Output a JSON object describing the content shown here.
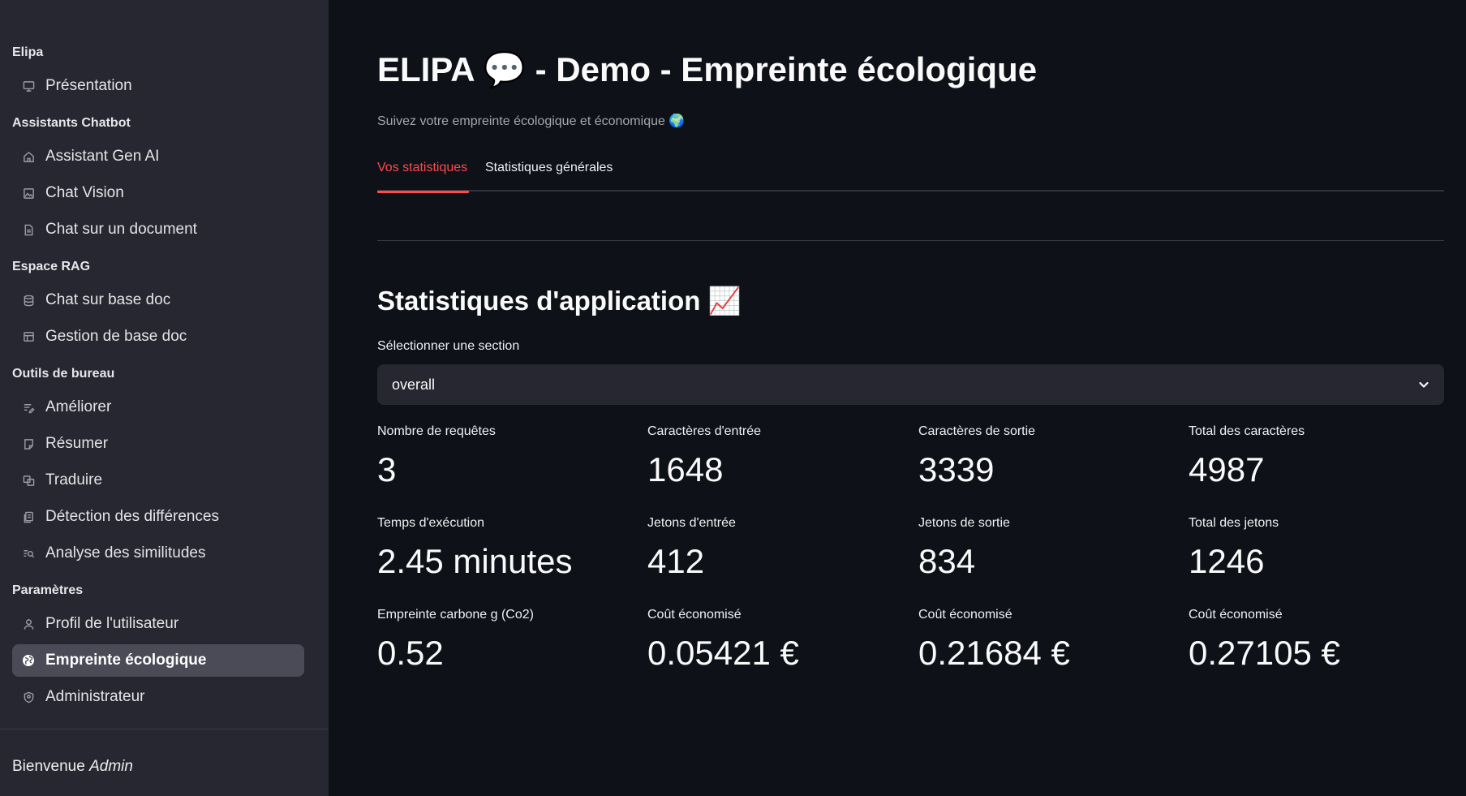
{
  "sidebar": {
    "groups": [
      {
        "title": "Elipa",
        "items": [
          {
            "label": "Présentation",
            "icon": "presentation-icon"
          }
        ]
      },
      {
        "title": "Assistants Chatbot",
        "items": [
          {
            "label": "Assistant Gen AI",
            "icon": "home-icon"
          },
          {
            "label": "Chat Vision",
            "icon": "image-icon"
          },
          {
            "label": "Chat sur un document",
            "icon": "document-icon"
          }
        ]
      },
      {
        "title": "Espace RAG",
        "items": [
          {
            "label": "Chat sur base doc",
            "icon": "database-icon"
          },
          {
            "label": "Gestion de base doc",
            "icon": "edit-table-icon"
          }
        ]
      },
      {
        "title": "Outils de bureau",
        "items": [
          {
            "label": "Améliorer",
            "icon": "edit-lines-icon"
          },
          {
            "label": "Résumer",
            "icon": "note-icon"
          },
          {
            "label": "Traduire",
            "icon": "translate-icon"
          },
          {
            "label": "Détection des différences",
            "icon": "compare-icon"
          },
          {
            "label": "Analyse des similitudes",
            "icon": "find-similar-icon"
          }
        ]
      },
      {
        "title": "Paramètres",
        "items": [
          {
            "label": "Profil de l'utilisateur",
            "icon": "user-icon"
          },
          {
            "label": "Empreinte écologique",
            "icon": "globe-icon",
            "active": true
          },
          {
            "label": "Administrateur",
            "icon": "admin-icon"
          }
        ]
      }
    ],
    "welcome_prefix": "Bienvenue",
    "welcome_user": "Admin"
  },
  "main": {
    "title": "ELIPA 💬 - Demo - Empreinte écologique",
    "subtitle": "Suivez votre empreinte écologique et économique 🌍",
    "tabs": [
      {
        "label": "Vos statistiques",
        "active": true
      },
      {
        "label": "Statistiques générales",
        "active": false
      }
    ],
    "section_title": "Statistiques d'application 📈",
    "select": {
      "label": "Sélectionner une section",
      "value": "overall"
    },
    "metrics": [
      {
        "label": "Nombre de requêtes",
        "value": "3"
      },
      {
        "label": "Caractères d'entrée",
        "value": "1648"
      },
      {
        "label": "Caractères de sortie",
        "value": "3339"
      },
      {
        "label": "Total des caractères",
        "value": "4987"
      },
      {
        "label": "Temps d'exécution",
        "value": "2.45 minutes"
      },
      {
        "label": "Jetons d'entrée",
        "value": "412"
      },
      {
        "label": "Jetons de sortie",
        "value": "834"
      },
      {
        "label": "Total des jetons",
        "value": "1246"
      },
      {
        "label": "Empreinte carbone g (Co2)",
        "value": "0.52"
      },
      {
        "label": "Coût économisé",
        "value": "0.05421 €"
      },
      {
        "label": "Coût économisé",
        "value": "0.21684 €"
      },
      {
        "label": "Coût économisé",
        "value": "0.27105 €"
      }
    ]
  },
  "colors": {
    "accent": "#ff4b4b",
    "background": "#0e1117",
    "sidebar": "#262730"
  }
}
